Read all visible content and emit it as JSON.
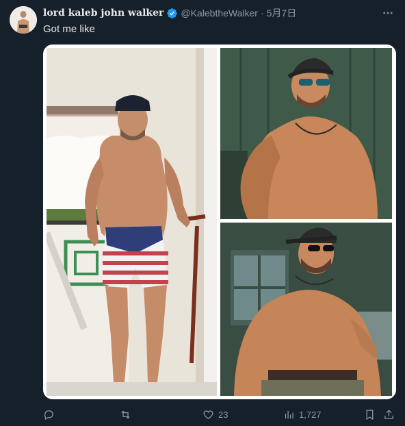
{
  "tweet": {
    "display_name": "lord kaleb john walker",
    "handle": "@KalebtheWalker",
    "separator": "·",
    "date": "5月7日",
    "text": "Got me like"
  },
  "metrics": {
    "likes": "23",
    "views": "1,727"
  },
  "colors": {
    "background": "#15202b",
    "text": "#e7e9ea",
    "muted": "#8b98a5",
    "verified": "#1d9bf0"
  },
  "icons": {
    "verified": "verified-badge-icon",
    "more": "more-icon",
    "reply": "reply-icon",
    "retweet": "retweet-icon",
    "like": "heart-icon",
    "views": "views-icon",
    "bookmark": "bookmark-icon",
    "share": "share-icon"
  }
}
